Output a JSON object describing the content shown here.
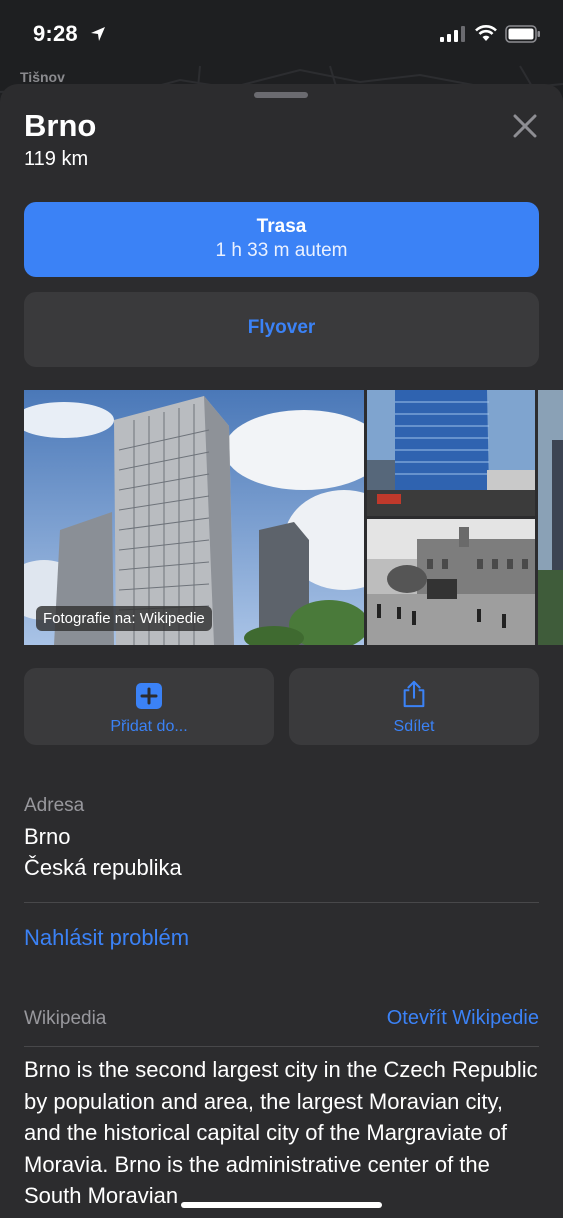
{
  "status_bar": {
    "time": "9:28"
  },
  "map": {
    "place_label": "Tišnov"
  },
  "place": {
    "name": "Brno",
    "distance": "119 km"
  },
  "route_button": {
    "title": "Trasa",
    "subtitle": "1 h 33 m autem"
  },
  "flyover_button": {
    "label": "Flyover"
  },
  "photos": {
    "credit": "Fotografie na: Wikipedie"
  },
  "actions": {
    "add_label": "Přidat do...",
    "share_label": "Sdílet"
  },
  "address": {
    "heading": "Adresa",
    "line1": "Brno",
    "line2": "Česká republika"
  },
  "report_link": "Nahlásit problém",
  "wikipedia": {
    "heading": "Wikipedia",
    "open_link": "Otevřít Wikipedie",
    "text": "Brno is the second largest city in the Czech Republic by population and area, the largest Moravian city, and the historical capital city of the Margraviate of Moravia. Brno is the administrative center of the South Moravian"
  },
  "colors": {
    "accent": "#3b82f6",
    "sheet": "#2c2c2e",
    "button_bg": "#3a3a3c"
  },
  "icons": [
    "location-arrow-icon",
    "signal-icon",
    "wifi-icon",
    "battery-icon",
    "close-icon",
    "add-square-icon",
    "share-icon"
  ]
}
